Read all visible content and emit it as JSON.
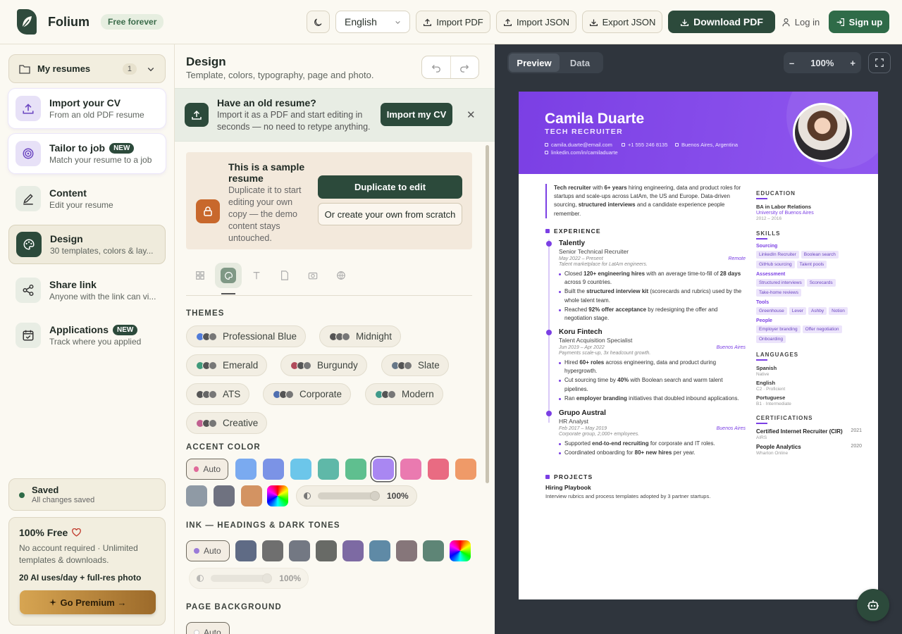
{
  "header": {
    "brand": "Folium",
    "tagline": "Free forever",
    "language": "English",
    "import_pdf": "Import PDF",
    "import_json": "Import JSON",
    "export_json": "Export JSON",
    "download_pdf": "Download PDF",
    "login": "Log in",
    "signup": "Sign up"
  },
  "sidebar": {
    "my_resumes": "My resumes",
    "my_resumes_count": "1",
    "items": [
      {
        "title": "Import your CV",
        "subtitle": "From an old PDF resume",
        "icon": "upload-icon"
      },
      {
        "title": "Tailor to job",
        "badge": "NEW",
        "subtitle": "Match your resume to a job",
        "icon": "target-icon"
      },
      {
        "title": "Content",
        "subtitle": "Edit your resume",
        "icon": "pen-icon"
      },
      {
        "title": "Design",
        "subtitle": "30 templates, colors & lay...",
        "icon": "palette-icon"
      },
      {
        "title": "Share link",
        "subtitle": "Anyone with the link can vi...",
        "icon": "share-icon"
      },
      {
        "title": "Applications",
        "badge": "NEW",
        "subtitle": "Track where you applied",
        "icon": "calendar-check-icon"
      }
    ],
    "saved_title": "Saved",
    "saved_sub": "All changes saved",
    "promo_title": "100% Free",
    "promo_text": "No account required · Unlimited templates & downloads.",
    "promo_ai": "20 AI uses/day + full-res photo",
    "premium": "Go Premium →"
  },
  "design": {
    "title": "Design",
    "subtitle": "Template, colors, typography, page and photo.",
    "banner_title": "Have an old resume?",
    "banner_text": "Import it as a PDF and start editing in seconds — no need to retype anything.",
    "banner_btn": "Import my CV",
    "sample_title": "This is a sample resume",
    "sample_text": "Duplicate it to start editing your own copy — the demo content stays untouched.",
    "dup_btn": "Duplicate to edit",
    "scratch_btn": "Or create your own from scratch",
    "themes_label": "THEMES",
    "themes": [
      "Professional Blue",
      "Midnight",
      "Emerald",
      "Burgundy",
      "Slate",
      "ATS",
      "Corporate",
      "Modern",
      "Creative"
    ],
    "accent_label": "ACCENT COLOR",
    "auto": "Auto",
    "accent_opacity": "100%",
    "accent_colors": [
      "#7aaaf0",
      "#7b93e6",
      "#6cc6ea",
      "#5fb8a8",
      "#5fbf8f",
      "#a987f2",
      "#ea7ab0",
      "#e96b82",
      "#ef9a68",
      "#8f9aa5",
      "#6f7280",
      "#d39362"
    ],
    "ink_label": "INK — HEADINGS & DARK TONES",
    "ink_opacity": "100%",
    "ink_colors": [
      "#5f6b85",
      "#6f6f6f",
      "#737883",
      "#686a66",
      "#7d6aa3",
      "#5f8aa6",
      "#86767a",
      "#5e8576"
    ],
    "bg_label": "PAGE BACKGROUND"
  },
  "preview": {
    "tab_preview": "Preview",
    "tab_data": "Data",
    "zoom": "100%",
    "resume": {
      "name": "Camila Duarte",
      "title": "TECH RECRUITER",
      "email": "camila.duarte@email.com",
      "phone": "+1 555 246 8135",
      "location": "Buenos Aires, Argentina",
      "linkedin": "linkedin.com/in/camiladuarte",
      "summary_html": "<b>Tech recruiter</b> with <b>6+ years</b> hiring engineering, data and product roles for startups and scale-ups across LatAm, the US and Europe. Data-driven sourcing, <b>structured interviews</b> and a candidate experience people remember.",
      "experience_label": "EXPERIENCE",
      "jobs": [
        {
          "company": "Talently",
          "role": "Senior Technical Recruiter",
          "dates": "May 2022 – Present",
          "location": "Remote",
          "desc": "Talent marketplace for LatAm engineers.",
          "bullets_html": [
            "Closed <b>120+ engineering hires</b> with an average time-to-fill of <b>28 days</b> across 9 countries.",
            "Built the <b>structured interview kit</b> (scorecards and rubrics) used by the whole talent team.",
            "Reached <b>92% offer acceptance</b> by redesigning the offer and negotiation stage."
          ]
        },
        {
          "company": "Koru Fintech",
          "role": "Talent Acquisition Specialist",
          "dates": "Jun 2019 – Apr 2022",
          "location": "Buenos Aires",
          "desc": "Payments scale-up, 3x headcount growth.",
          "bullets_html": [
            "Hired <b>60+ roles</b> across engineering, data and product during hypergrowth.",
            "Cut sourcing time by <b>40%</b> with Boolean search and warm talent pipelines.",
            "Ran <b>employer branding</b> initiatives that doubled inbound applications."
          ]
        },
        {
          "company": "Grupo Austral",
          "role": "HR Analyst",
          "dates": "Feb 2017 – May 2019",
          "location": "Buenos Aires",
          "desc": "Corporate group, 2,000+ employees.",
          "bullets_html": [
            "Supported <b>end-to-end recruiting</b> for corporate and IT roles.",
            "Coordinated onboarding for <b>80+ new hires</b> per year."
          ]
        }
      ],
      "projects_label": "PROJECTS",
      "project_title": "Hiring Playbook",
      "project_desc": "Interview rubrics and process templates adopted by 3 partner startups.",
      "education_label": "EDUCATION",
      "degree": "BA in Labor Relations",
      "school": "University of Buenos Aires",
      "edu_dates": "2012 – 2016",
      "skills_label": "SKILLS",
      "skill_groups": [
        {
          "name": "Sourcing",
          "items": [
            "LinkedIn Recruiter",
            "Boolean search",
            "GitHub sourcing",
            "Talent pools"
          ]
        },
        {
          "name": "Assessment",
          "items": [
            "Structured interviews",
            "Scorecards",
            "Take-home reviews"
          ]
        },
        {
          "name": "Tools",
          "items": [
            "Greenhouse",
            "Lever",
            "Ashby",
            "Notion"
          ]
        },
        {
          "name": "People",
          "items": [
            "Employer branding",
            "Offer negotiation",
            "Onboarding"
          ]
        }
      ],
      "languages_label": "LANGUAGES",
      "languages": [
        {
          "name": "Spanish",
          "level": "Native"
        },
        {
          "name": "English",
          "level": "C2 · Proficient"
        },
        {
          "name": "Portuguese",
          "level": "B1 · Intermediate"
        }
      ],
      "certs_label": "CERTIFICATIONS",
      "certs": [
        {
          "name": "Certified Internet Recruiter (CIR)",
          "org": "AIRS",
          "year": "2021"
        },
        {
          "name": "People Analytics",
          "org": "Wharton Online",
          "year": "2020"
        }
      ]
    }
  }
}
